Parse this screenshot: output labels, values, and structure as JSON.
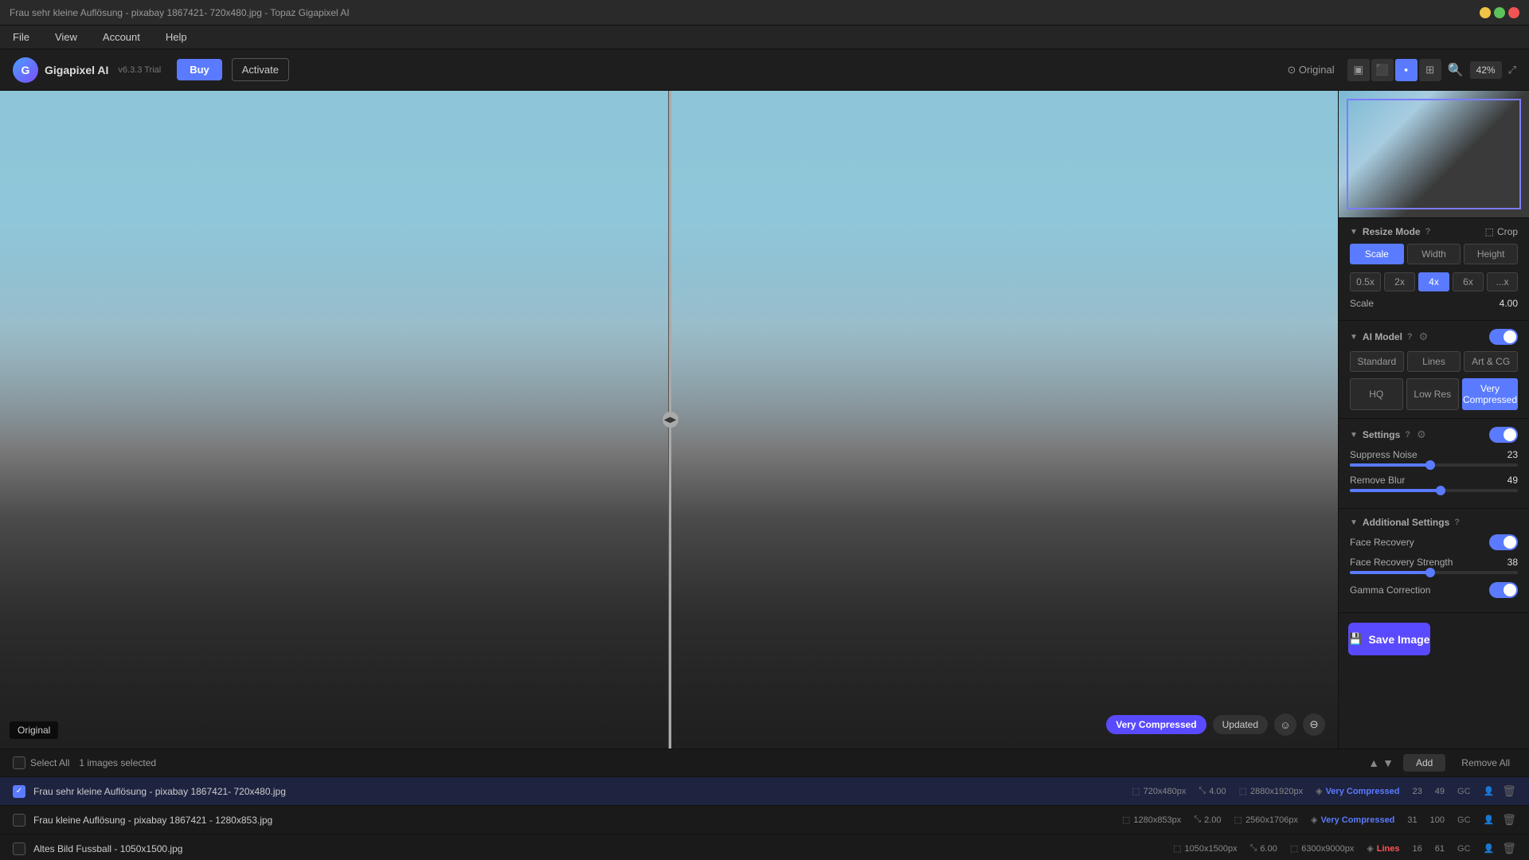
{
  "titleBar": {
    "title": "Frau sehr kleine Auflösung - pixabay 1867421- 720x480.jpg - Topaz Gigapixel AI"
  },
  "menuBar": {
    "items": [
      "File",
      "View",
      "Account",
      "Help"
    ]
  },
  "header": {
    "logoText": "G",
    "appName": "Gigapixel AI",
    "version": "v6.3.3 Trial",
    "buyLabel": "Buy",
    "activateLabel": "Activate",
    "originalLabel": "Original",
    "zoomLevel": "42%"
  },
  "rightPanel": {
    "resizeMode": {
      "label": "Resize Mode",
      "cropLabel": "Crop",
      "scaleOptions": [
        "Scale",
        "Width",
        "Height"
      ],
      "activeScale": "Scale",
      "scaleMultipliers": [
        "0.5x",
        "2x",
        "4x",
        "6x",
        "...x"
      ],
      "activeMultiplier": "4x",
      "scaleLabel": "Scale",
      "scaleValue": "4.00"
    },
    "aiModel": {
      "label": "AI Model",
      "modelTypes": [
        "Standard",
        "Lines",
        "Art & CG"
      ],
      "qualities": [
        "HQ",
        "Low Res",
        "Very Compressed"
      ],
      "activeQuality": "Very Compressed"
    },
    "settings": {
      "label": "Settings",
      "suppressNoise": {
        "label": "Suppress Noise",
        "value": 23,
        "fillPercent": 48
      },
      "removeBlur": {
        "label": "Remove Blur",
        "value": 49,
        "fillPercent": 54
      }
    },
    "additionalSettings": {
      "label": "Additional Settings",
      "faceRecovery": {
        "label": "Face Recovery",
        "enabled": true
      },
      "faceRecoveryStrength": {
        "label": "Face Recovery Strength",
        "value": 38,
        "fillPercent": 48
      },
      "gammaCorrection": {
        "label": "Gamma Correction",
        "enabled": true
      }
    },
    "saveButton": "Save Image"
  },
  "canvas": {
    "leftLabel": "Original",
    "statusBadge": "Very Compressed",
    "updatedBadge": "Updated"
  },
  "fileList": {
    "selectAllLabel": "Select All",
    "selectedInfo": "1 images selected",
    "addLabel": "Add",
    "removeAllLabel": "Remove All",
    "files": [
      {
        "id": 1,
        "selected": true,
        "checked": true,
        "name": "Frau sehr kleine Auflösung - pixabay 1867421- 720x480.jpg",
        "srcRes": "720x480px",
        "scale": "4.00",
        "outRes": "2880x1920px",
        "aiModel": "Very Compressed",
        "aiColor": "blue",
        "noise": "23",
        "blur": "49",
        "gc": "GC"
      },
      {
        "id": 2,
        "selected": false,
        "checked": false,
        "name": "Frau kleine Auflösung - pixabay 1867421 - 1280x853.jpg",
        "srcRes": "1280x853px",
        "scale": "2.00",
        "outRes": "2560x1706px",
        "aiModel": "Very Compressed",
        "aiColor": "blue",
        "noise": "31",
        "blur": "100",
        "gc": "GC"
      },
      {
        "id": 3,
        "selected": false,
        "checked": false,
        "name": "Altes Bild Fussball - 1050x1500.jpg",
        "srcRes": "1050x1500px",
        "scale": "6.00",
        "outRes": "6300x9000px",
        "aiModel": "Lines",
        "aiColor": "red",
        "noise": "16",
        "blur": "61",
        "gc": "GC"
      }
    ]
  }
}
